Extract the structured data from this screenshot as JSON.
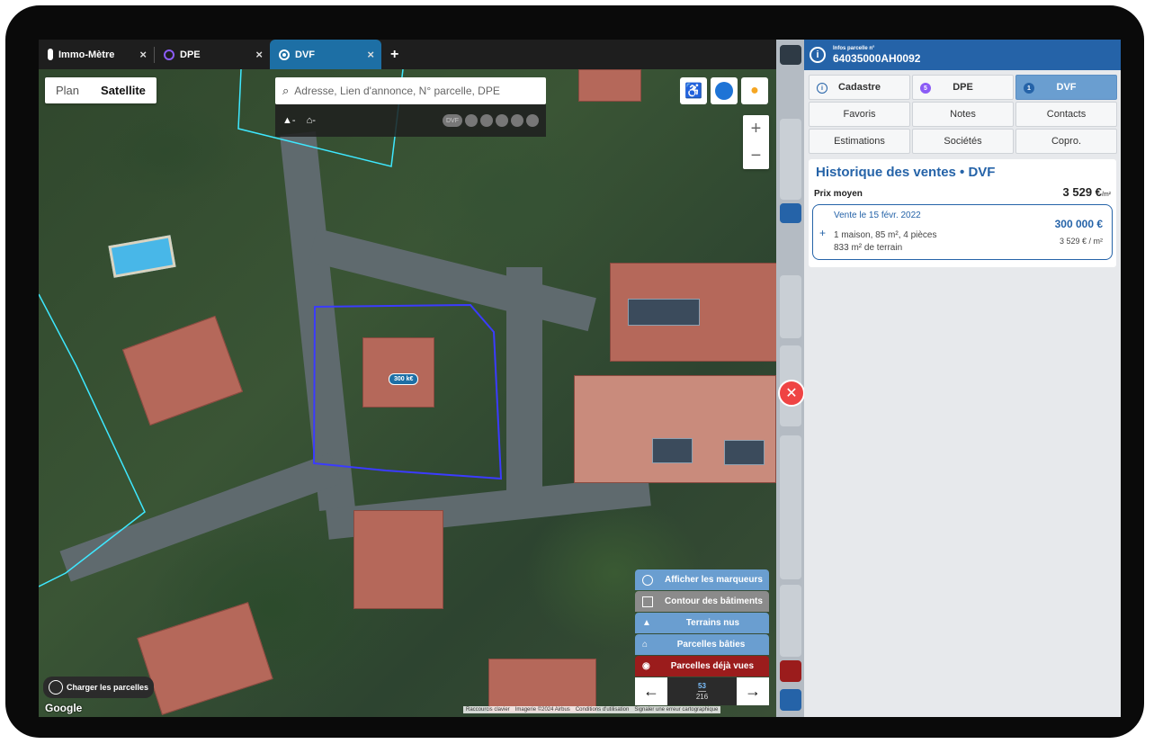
{
  "tabs": [
    {
      "label": "Immo-Mètre",
      "icon": "thermometer-icon"
    },
    {
      "label": "DPE",
      "icon": "dpe-ring-icon"
    },
    {
      "label": "DVF",
      "icon": "dvf-target-icon",
      "active": true
    }
  ],
  "tab_add": "+",
  "tab_close": "×",
  "map": {
    "type_plan": "Plan",
    "type_satellite": "Satellite",
    "search_placeholder": "Adresse, Lien d'annonce, N° parcelle, DPE",
    "filter_tree": "-",
    "filter_house": "-",
    "dvf_chip": "DVF",
    "price_pin": "300 k€",
    "load_parcels": "Charger les parcelles",
    "google": "Google",
    "attribution": [
      "Raccourcis clavier",
      "Imagerie ©2024 Airbus",
      "Conditions d'utilisation",
      "Signaler une erreur cartographique"
    ],
    "layers": [
      {
        "label": "Afficher les marqueurs"
      },
      {
        "label": "Contour des bâtiments"
      },
      {
        "label": "Terrains nus"
      },
      {
        "label": "Parcelles bâties"
      },
      {
        "label": "Parcelles déjà vues"
      }
    ],
    "pager": {
      "current": "53",
      "total": "216"
    }
  },
  "panel": {
    "header_small": "Infos parcelle n°",
    "parcel_id": "64035000AH0092",
    "buttons": [
      {
        "label": "Cadastre",
        "prefix": "i"
      },
      {
        "label": "DPE",
        "prefix": "5"
      },
      {
        "label": "DVF",
        "prefix": "1"
      },
      {
        "label": "Favoris"
      },
      {
        "label": "Notes"
      },
      {
        "label": "Contacts"
      },
      {
        "label": "Estimations"
      },
      {
        "label": "Sociétés"
      },
      {
        "label": "Copro."
      }
    ],
    "history_title": "Historique des ventes • DVF",
    "avg_label": "Prix moyen",
    "avg_value": "3 529 €",
    "avg_unit": "/m²",
    "sale": {
      "date": "Vente le 15 févr. 2022",
      "desc1": "1 maison, 85 m², 4 pièces",
      "desc2": "833 m² de terrain",
      "price": "300 000 €",
      "price_per_m2": "3 529 € / m²"
    }
  },
  "colors": {
    "accent": "#2563a8",
    "dvf_tab": "#1d6fa5",
    "close": "#ef4444",
    "seen": "#9b1c1c"
  }
}
